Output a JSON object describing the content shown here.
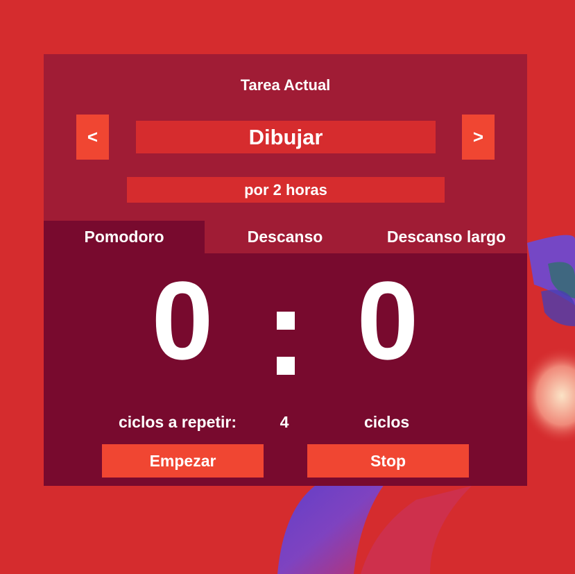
{
  "colors": {
    "background": "#d52c2e",
    "panel": "#a01c35",
    "panel_dark": "#780a2e",
    "accent": "#f04632",
    "field": "#d62c2e",
    "text": "#ffffff"
  },
  "task": {
    "heading": "Tarea Actual",
    "prev_label": "<",
    "next_label": ">",
    "name": "Dibujar",
    "duration": "por 2 horas"
  },
  "tabs": [
    {
      "label": "Pomodoro",
      "active": true
    },
    {
      "label": "Descanso",
      "active": false
    },
    {
      "label": "Descanso largo",
      "active": false
    }
  ],
  "timer": {
    "minutes": "0",
    "seconds": "0"
  },
  "cycles": {
    "label": "ciclos a repetir:",
    "value": "4",
    "unit": "ciclos"
  },
  "actions": {
    "start_label": "Empezar",
    "stop_label": "Stop"
  }
}
